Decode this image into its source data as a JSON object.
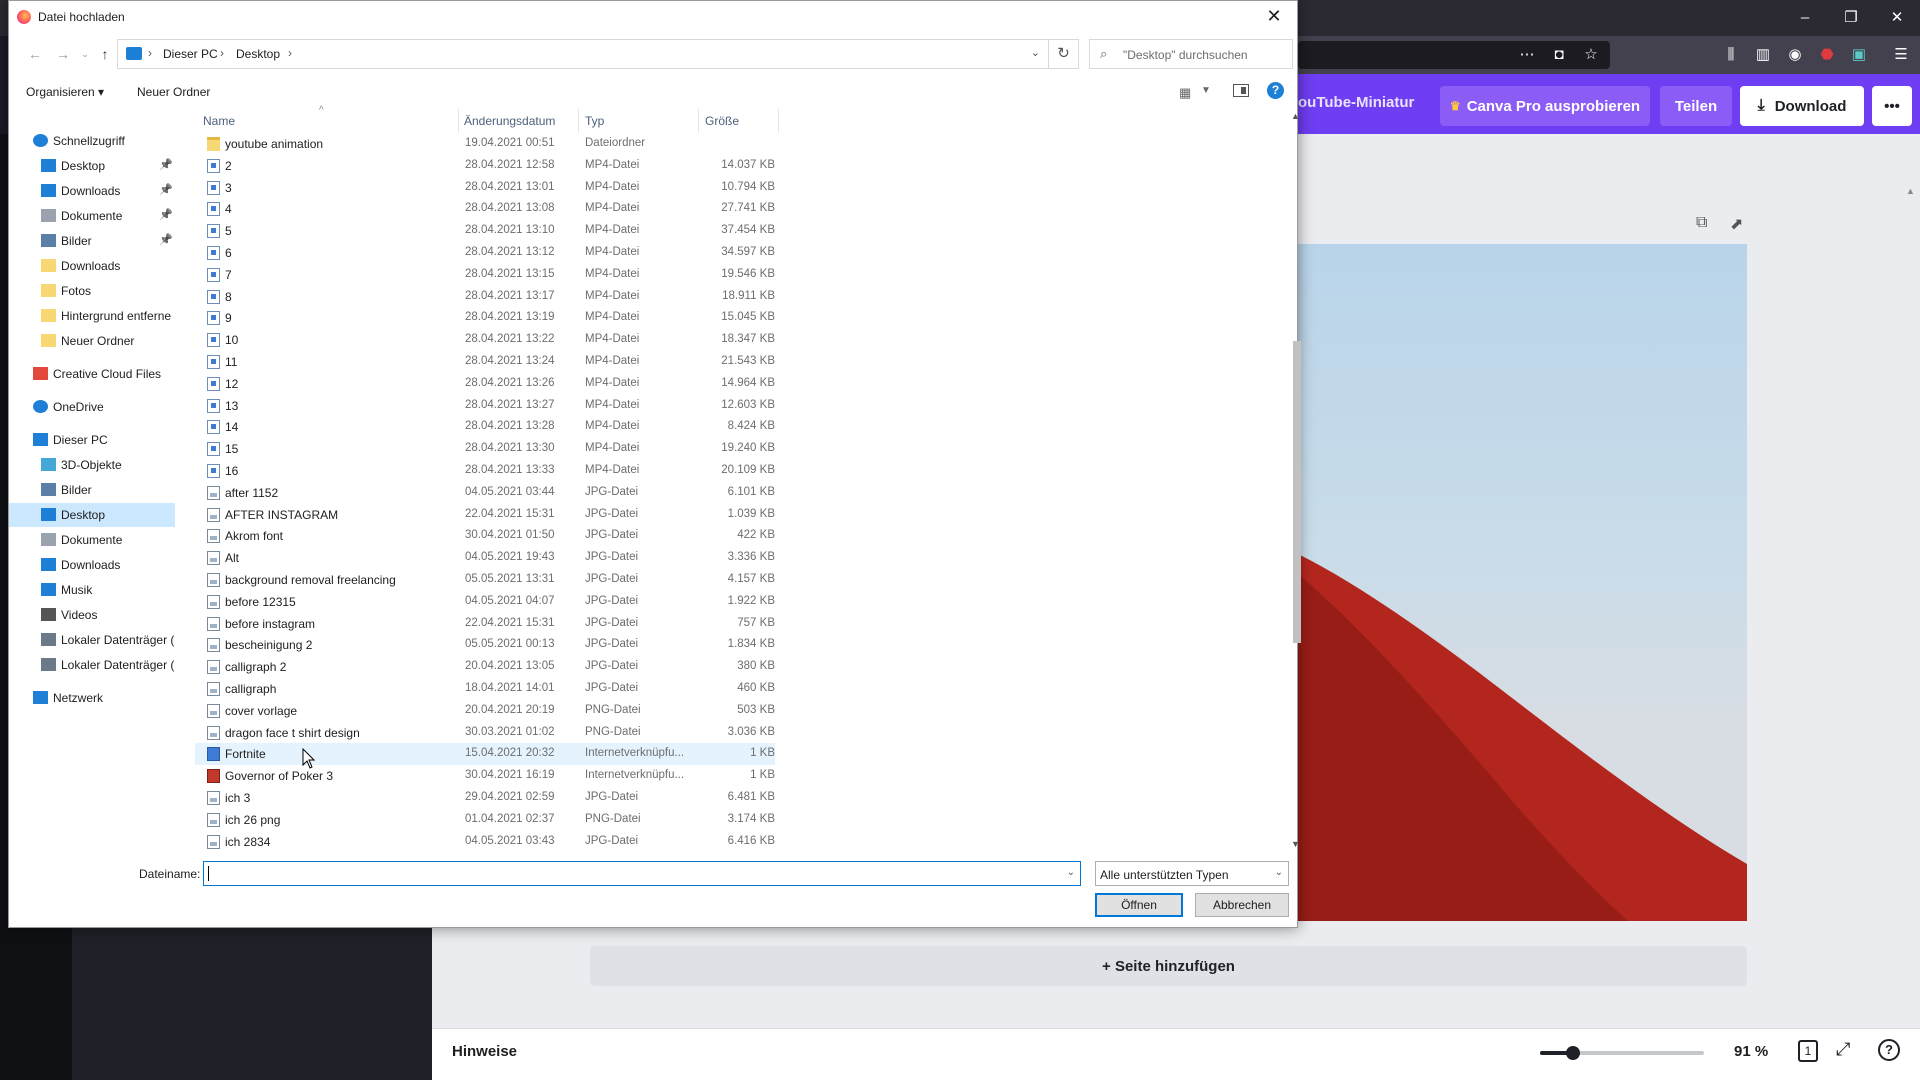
{
  "dialog": {
    "title": "Datei hochladen",
    "close_glyph": "✕",
    "address": {
      "crumb1": "Dieser PC",
      "crumb2": "Desktop",
      "sep": "›"
    },
    "search_placeholder": "\"Desktop\" durchsuchen",
    "commands": {
      "organize": "Organisieren ▾",
      "new_folder": "Neuer Ordner"
    },
    "columns": {
      "name": "Name",
      "date": "Änderungsdatum",
      "type": "Typ",
      "size": "Größe"
    },
    "nav_items": [
      {
        "label": "Schnellzugriff",
        "icon": "star-icon"
      },
      {
        "label": "Desktop",
        "icon": "desktop-icon",
        "pinned": true
      },
      {
        "label": "Downloads",
        "icon": "download-icon",
        "pinned": true
      },
      {
        "label": "Dokumente",
        "icon": "document-icon",
        "pinned": true
      },
      {
        "label": "Bilder",
        "icon": "pictures-icon",
        "pinned": true
      },
      {
        "label": "Downloads",
        "icon": "folder-icon"
      },
      {
        "label": "Fotos",
        "icon": "folder-icon"
      },
      {
        "label": "Hintergrund entferne",
        "icon": "folder-icon"
      },
      {
        "label": "Neuer Ordner",
        "icon": "folder-icon"
      },
      {
        "label": "Creative Cloud Files",
        "icon": "creative-cloud-icon"
      },
      {
        "label": "OneDrive",
        "icon": "cloud-icon"
      },
      {
        "label": "Dieser PC",
        "icon": "computer-icon"
      },
      {
        "label": "3D-Objekte",
        "icon": "cube-icon"
      },
      {
        "label": "Bilder",
        "icon": "pictures-icon"
      },
      {
        "label": "Desktop",
        "icon": "desktop-icon",
        "selected": true
      },
      {
        "label": "Dokumente",
        "icon": "document-icon"
      },
      {
        "label": "Downloads",
        "icon": "download-icon"
      },
      {
        "label": "Musik",
        "icon": "music-icon"
      },
      {
        "label": "Videos",
        "icon": "video-icon"
      },
      {
        "label": "Lokaler Datenträger (C",
        "icon": "drive-icon"
      },
      {
        "label": "Lokaler Datenträger (I",
        "icon": "drive-icon"
      },
      {
        "label": "Netzwerk",
        "icon": "network-icon"
      }
    ],
    "files": [
      {
        "name": "youtube animation",
        "date": "19.04.2021 00:51",
        "type": "Dateiordner",
        "size": "",
        "icon": "folder"
      },
      {
        "name": "2",
        "date": "28.04.2021 12:58",
        "type": "MP4-Datei",
        "size": "14.037 KB",
        "icon": "mp4"
      },
      {
        "name": "3",
        "date": "28.04.2021 13:01",
        "type": "MP4-Datei",
        "size": "10.794 KB",
        "icon": "mp4"
      },
      {
        "name": "4",
        "date": "28.04.2021 13:08",
        "type": "MP4-Datei",
        "size": "27.741 KB",
        "icon": "mp4"
      },
      {
        "name": "5",
        "date": "28.04.2021 13:10",
        "type": "MP4-Datei",
        "size": "37.454 KB",
        "icon": "mp4"
      },
      {
        "name": "6",
        "date": "28.04.2021 13:12",
        "type": "MP4-Datei",
        "size": "34.597 KB",
        "icon": "mp4"
      },
      {
        "name": "7",
        "date": "28.04.2021 13:15",
        "type": "MP4-Datei",
        "size": "19.546 KB",
        "icon": "mp4"
      },
      {
        "name": "8",
        "date": "28.04.2021 13:17",
        "type": "MP4-Datei",
        "size": "18.911 KB",
        "icon": "mp4"
      },
      {
        "name": "9",
        "date": "28.04.2021 13:19",
        "type": "MP4-Datei",
        "size": "15.045 KB",
        "icon": "mp4"
      },
      {
        "name": "10",
        "date": "28.04.2021 13:22",
        "type": "MP4-Datei",
        "size": "18.347 KB",
        "icon": "mp4"
      },
      {
        "name": "11",
        "date": "28.04.2021 13:24",
        "type": "MP4-Datei",
        "size": "21.543 KB",
        "icon": "mp4"
      },
      {
        "name": "12",
        "date": "28.04.2021 13:26",
        "type": "MP4-Datei",
        "size": "14.964 KB",
        "icon": "mp4"
      },
      {
        "name": "13",
        "date": "28.04.2021 13:27",
        "type": "MP4-Datei",
        "size": "12.603 KB",
        "icon": "mp4"
      },
      {
        "name": "14",
        "date": "28.04.2021 13:28",
        "type": "MP4-Datei",
        "size": "8.424 KB",
        "icon": "mp4"
      },
      {
        "name": "15",
        "date": "28.04.2021 13:30",
        "type": "MP4-Datei",
        "size": "19.240 KB",
        "icon": "mp4"
      },
      {
        "name": "16",
        "date": "28.04.2021 13:33",
        "type": "MP4-Datei",
        "size": "20.109 KB",
        "icon": "mp4"
      },
      {
        "name": "after 1152",
        "date": "04.05.2021 03:44",
        "type": "JPG-Datei",
        "size": "6.101 KB",
        "icon": "img"
      },
      {
        "name": "AFTER INSTAGRAM",
        "date": "22.04.2021 15:31",
        "type": "JPG-Datei",
        "size": "1.039 KB",
        "icon": "img"
      },
      {
        "name": "Akrom font",
        "date": "30.04.2021 01:50",
        "type": "JPG-Datei",
        "size": "422 KB",
        "icon": "img"
      },
      {
        "name": "Alt",
        "date": "04.05.2021 19:43",
        "type": "JPG-Datei",
        "size": "3.336 KB",
        "icon": "img"
      },
      {
        "name": "background removal freelancing",
        "date": "05.05.2021 13:31",
        "type": "JPG-Datei",
        "size": "4.157 KB",
        "icon": "img"
      },
      {
        "name": "before 12315",
        "date": "04.05.2021 04:07",
        "type": "JPG-Datei",
        "size": "1.922 KB",
        "icon": "img"
      },
      {
        "name": "before instagram",
        "date": "22.04.2021 15:31",
        "type": "JPG-Datei",
        "size": "757 KB",
        "icon": "img"
      },
      {
        "name": "bescheinigung 2",
        "date": "05.05.2021 00:13",
        "type": "JPG-Datei",
        "size": "1.834 KB",
        "icon": "img"
      },
      {
        "name": "calligraph 2",
        "date": "20.04.2021 13:05",
        "type": "JPG-Datei",
        "size": "380 KB",
        "icon": "img"
      },
      {
        "name": "calligraph",
        "date": "18.04.2021 14:01",
        "type": "JPG-Datei",
        "size": "460 KB",
        "icon": "img"
      },
      {
        "name": "cover vorlage",
        "date": "20.04.2021 20:19",
        "type": "PNG-Datei",
        "size": "503 KB",
        "icon": "img"
      },
      {
        "name": "dragon face t shirt design",
        "date": "30.03.2021 01:02",
        "type": "PNG-Datei",
        "size": "3.036 KB",
        "icon": "img"
      },
      {
        "name": "Fortnite",
        "date": "15.04.2021 20:32",
        "type": "Internetverknüpfu...",
        "size": "1 KB",
        "icon": "link",
        "hover": true
      },
      {
        "name": "Governor of Poker 3",
        "date": "30.04.2021 16:19",
        "type": "Internetverknüpfu...",
        "size": "1 KB",
        "icon": "link2"
      },
      {
        "name": "ich 3",
        "date": "29.04.2021 02:59",
        "type": "JPG-Datei",
        "size": "6.481 KB",
        "icon": "img"
      },
      {
        "name": "ich 26 png",
        "date": "01.04.2021 02:37",
        "type": "PNG-Datei",
        "size": "3.174 KB",
        "icon": "img"
      },
      {
        "name": "ich 2834",
        "date": "04.05.2021 03:43",
        "type": "JPG-Datei",
        "size": "6.416 KB",
        "icon": "img"
      }
    ],
    "filename_label": "Dateiname:",
    "filename_value": "",
    "filetype": "Alle unterstützten Typen",
    "open_label": "Öffnen",
    "cancel_label": "Abbrechen"
  },
  "canva": {
    "doc_title": "ouTube-Miniatur",
    "pro_label": "Canva Pro ausprobieren",
    "share_label": "Teilen",
    "download_label": "Download",
    "more_glyph": "•••",
    "add_page_label": "+ Seite hinzufügen",
    "notes_label": "Hinweise",
    "zoom": "91 %",
    "page_count": "1",
    "zoom_level": 0.2,
    "colors": {
      "brand": "#6f3df2",
      "pro_button": "#8b5cf6",
      "download_bg": "#ffffff"
    }
  }
}
